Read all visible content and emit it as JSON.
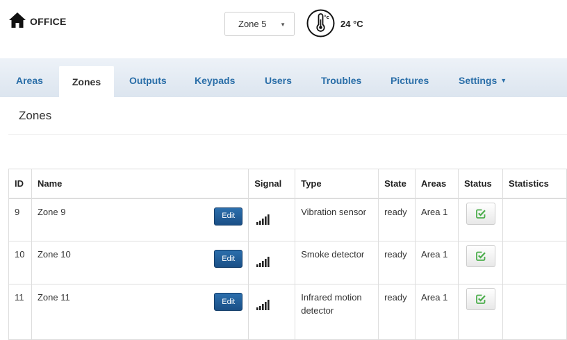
{
  "header": {
    "brand_label": "OFFICE",
    "zone_selector_value": "Zone 5",
    "temperature": "24 °C"
  },
  "nav": {
    "tabs": [
      {
        "label": "Areas"
      },
      {
        "label": "Zones"
      },
      {
        "label": "Outputs"
      },
      {
        "label": "Keypads"
      },
      {
        "label": "Users"
      },
      {
        "label": "Troubles"
      },
      {
        "label": "Pictures"
      },
      {
        "label": "Settings"
      }
    ],
    "active_tab": "Zones"
  },
  "page": {
    "title": "Zones"
  },
  "table": {
    "headers": [
      "ID",
      "Name",
      "Signal",
      "Type",
      "State",
      "Areas",
      "Status",
      "Statistics"
    ],
    "edit_label": "Edit",
    "rows": [
      {
        "id": "9",
        "name": "Zone 9",
        "type": "Vibration sensor",
        "state": "ready",
        "area": "Area 1"
      },
      {
        "id": "10",
        "name": "Zone 10",
        "type": "Smoke detector",
        "state": "ready",
        "area": "Area 1"
      },
      {
        "id": "11",
        "name": "Zone 11",
        "type": "Infrared motion detector",
        "state": "ready",
        "area": "Area 1"
      }
    ]
  },
  "colors": {
    "link": "#2a6ea8",
    "edit_button": "#1a4f86",
    "status_check": "#4cae4c"
  }
}
